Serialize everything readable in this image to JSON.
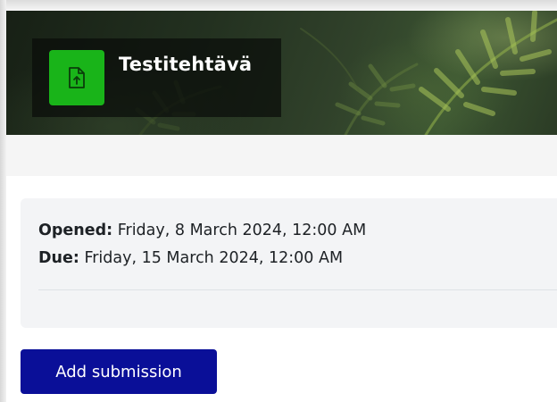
{
  "activity": {
    "title": "Testitehtävä",
    "icon": "assignment-upload-icon",
    "icon_color": "#19b419"
  },
  "dates": {
    "opened_label": "Opened:",
    "opened_value": "Friday, 8 March 2024, 12:00 AM",
    "due_label": "Due:",
    "due_value": "Friday, 15 March 2024, 12:00 AM"
  },
  "actions": {
    "add_submission_label": "Add submission",
    "button_color": "#0a0f98"
  }
}
